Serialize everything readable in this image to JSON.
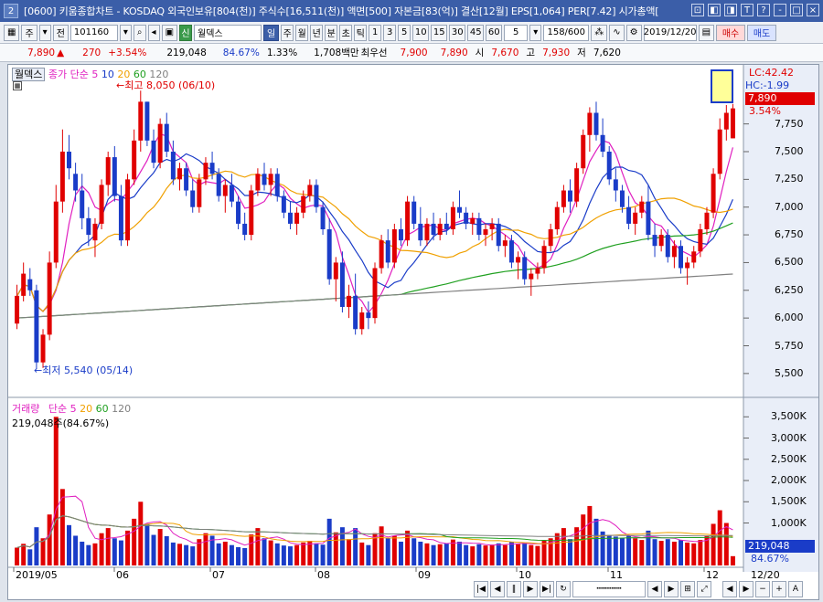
{
  "titlebar": {
    "badge": "2",
    "title": "[0600] 키움종합차트 - KOSDAQ 외국인보유[804(천)] 주식수[16,511(천)] 액면[500] 자본금[83(억)] 결산[12월] EPS[1,064] PER[7.42] 시가총액[",
    "btns": [
      "⊡",
      "◧",
      "◨",
      "T",
      "?",
      "-",
      "□",
      "×"
    ]
  },
  "toolbar": {
    "period_type": "주",
    "prev": "전",
    "code": "101160",
    "stock_name": "월덱스",
    "mode_active": "일",
    "modes": [
      "주",
      "월",
      "년",
      "분",
      "초",
      "틱"
    ],
    "ticks": [
      "1",
      "3",
      "5",
      "10",
      "15",
      "30",
      "45",
      "60"
    ],
    "interval": "5",
    "count": "158/600",
    "date": "2019/12/20",
    "buy": "매수",
    "sell": "매도",
    "sin": "신"
  },
  "infobar": {
    "price": "7,890",
    "arrow": "▲",
    "change": "270",
    "pct": "+3.54%",
    "volume": "219,048",
    "vol_pct": "84.67%",
    "ratio": "1.33%",
    "amount": "1,708백만",
    "best_label": "최우선",
    "best_ask": "7,900",
    "best_bid": "7,890",
    "open_label": "시",
    "open": "7,670",
    "high_label": "고",
    "high": "7,930",
    "low_label": "저",
    "low": "7,620"
  },
  "price_panel": {
    "name": "월덱스",
    "ma_label": "종가 단순",
    "ma_periods": [
      "5",
      "10",
      "20",
      "60",
      "120"
    ],
    "high_note": "최고 8,050 (06/10)",
    "low_note": "최저 5,540 (05/14)",
    "lc": "LC:42.42",
    "hc": "HC:-1.99",
    "last": "7,890",
    "last_pct": "3.54%",
    "ticks": [
      "7,750",
      "7,500",
      "7,250",
      "7,000",
      "6,750",
      "6,500",
      "6,250",
      "6,000",
      "5,750",
      "5,500"
    ]
  },
  "volume_panel": {
    "name": "거래량",
    "ma_label": "단순",
    "ma_periods": [
      "5",
      "20",
      "60",
      "120"
    ],
    "current": "219,048주(84.67%)",
    "ticks": [
      "3,500K",
      "3,000K",
      "2,500K",
      "2,000K",
      "1,500K",
      "1,000K"
    ],
    "last": "219,048",
    "last_pct": "84.67%"
  },
  "xaxis": {
    "labels": [
      "2019/05",
      "06",
      "07",
      "08",
      "09",
      "10",
      "11",
      "12"
    ],
    "right_label": "12/20"
  },
  "colors": {
    "up": "#e00000",
    "down": "#1a3cc8",
    "ma5": "#e020c0",
    "ma10": "#1a3cc8",
    "ma20": "#f0a000",
    "ma60": "#20a020",
    "ma120": "#808080"
  },
  "chart_data": {
    "type": "candlestick",
    "title": "월덱스",
    "ylim": [
      5400,
      8200
    ],
    "candles": [
      [
        5950,
        6300,
        5900,
        6200
      ],
      [
        6200,
        6500,
        6150,
        6400
      ],
      [
        6350,
        6450,
        6200,
        6250
      ],
      [
        6250,
        6300,
        5540,
        5600
      ],
      [
        5600,
        5900,
        5550,
        5850
      ],
      [
        5850,
        6600,
        5800,
        6500
      ],
      [
        6500,
        7200,
        6450,
        7050
      ],
      [
        7050,
        7700,
        6950,
        7500
      ],
      [
        7500,
        7650,
        7250,
        7350
      ],
      [
        7300,
        7400,
        7050,
        7150
      ],
      [
        7150,
        7300,
        6800,
        6900
      ],
      [
        6900,
        7000,
        6650,
        6750
      ],
      [
        6700,
        6900,
        6550,
        6850
      ],
      [
        6850,
        7250,
        6800,
        7200
      ],
      [
        7200,
        7500,
        7100,
        7450
      ],
      [
        7450,
        7550,
        7050,
        7100
      ],
      [
        7100,
        7200,
        6650,
        6700
      ],
      [
        6700,
        7300,
        6650,
        7250
      ],
      [
        7250,
        7700,
        7200,
        7600
      ],
      [
        7600,
        8050,
        7500,
        7950
      ],
      [
        7950,
        7950,
        7550,
        7600
      ],
      [
        7600,
        7700,
        7350,
        7400
      ],
      [
        7400,
        7800,
        7350,
        7750
      ],
      [
        7750,
        7850,
        7450,
        7500
      ],
      [
        7500,
        7600,
        7200,
        7250
      ],
      [
        7250,
        7400,
        7150,
        7350
      ],
      [
        7350,
        7400,
        7100,
        7150
      ],
      [
        7150,
        7250,
        6950,
        7000
      ],
      [
        7000,
        7300,
        6950,
        7250
      ],
      [
        7250,
        7450,
        7200,
        7400
      ],
      [
        7400,
        7500,
        7250,
        7300
      ],
      [
        7300,
        7350,
        7050,
        7100
      ],
      [
        7100,
        7250,
        6950,
        7200
      ],
      [
        7200,
        7300,
        7000,
        7050
      ],
      [
        7050,
        7100,
        6800,
        6850
      ],
      [
        6850,
        6950,
        6700,
        6750
      ],
      [
        6750,
        7200,
        6700,
        7150
      ],
      [
        7150,
        7350,
        7100,
        7300
      ],
      [
        7300,
        7400,
        7150,
        7200
      ],
      [
        7200,
        7350,
        7100,
        7300
      ],
      [
        7300,
        7350,
        7050,
        7100
      ],
      [
        7100,
        7150,
        6900,
        6950
      ],
      [
        6950,
        7050,
        6800,
        6850
      ],
      [
        6850,
        7000,
        6750,
        6950
      ],
      [
        6950,
        7150,
        6900,
        7100
      ],
      [
        7100,
        7250,
        7050,
        7200
      ],
      [
        7200,
        7250,
        6950,
        7000
      ],
      [
        7000,
        7050,
        6750,
        6800
      ],
      [
        6800,
        6900,
        6300,
        6350
      ],
      [
        6350,
        6550,
        6150,
        6500
      ],
      [
        6500,
        6600,
        6050,
        6100
      ],
      [
        6100,
        6300,
        6000,
        6200
      ],
      [
        6200,
        6400,
        5850,
        5900
      ],
      [
        5900,
        6100,
        5850,
        6050
      ],
      [
        6050,
        6150,
        5900,
        6000
      ],
      [
        6000,
        6500,
        5950,
        6450
      ],
      [
        6450,
        6750,
        6400,
        6700
      ],
      [
        6700,
        6800,
        6450,
        6500
      ],
      [
        6500,
        6850,
        6450,
        6800
      ],
      [
        6800,
        6900,
        6650,
        6700
      ],
      [
        6700,
        7100,
        6650,
        7050
      ],
      [
        7050,
        7100,
        6800,
        6850
      ],
      [
        6850,
        7000,
        6650,
        6700
      ],
      [
        6700,
        6900,
        6650,
        6850
      ],
      [
        6850,
        6950,
        6700,
        6750
      ],
      [
        6750,
        6900,
        6700,
        6850
      ],
      [
        6850,
        6950,
        6750,
        6800
      ],
      [
        6800,
        7050,
        6750,
        7000
      ],
      [
        7000,
        7150,
        6900,
        6950
      ],
      [
        6950,
        7000,
        6800,
        6850
      ],
      [
        6850,
        6950,
        6750,
        6900
      ],
      [
        6900,
        6950,
        6700,
        6750
      ],
      [
        6750,
        6850,
        6650,
        6800
      ],
      [
        6800,
        6900,
        6700,
        6850
      ],
      [
        6850,
        6900,
        6600,
        6650
      ],
      [
        6650,
        6750,
        6550,
        6700
      ],
      [
        6700,
        6750,
        6450,
        6500
      ],
      [
        6500,
        6600,
        6350,
        6550
      ],
      [
        6550,
        6600,
        6300,
        6350
      ],
      [
        6350,
        6450,
        6200,
        6400
      ],
      [
        6400,
        6500,
        6350,
        6450
      ],
      [
        6450,
        6700,
        6400,
        6650
      ],
      [
        6650,
        6850,
        6600,
        6800
      ],
      [
        6800,
        7050,
        6750,
        7000
      ],
      [
        7000,
        7200,
        6950,
        7150
      ],
      [
        7150,
        7250,
        6950,
        7050
      ],
      [
        7050,
        7400,
        7000,
        7350
      ],
      [
        7350,
        7700,
        7300,
        7650
      ],
      [
        7650,
        7900,
        7500,
        7850
      ],
      [
        7850,
        7950,
        7600,
        7650
      ],
      [
        7650,
        7800,
        7450,
        7500
      ],
      [
        7500,
        7550,
        7200,
        7250
      ],
      [
        7250,
        7350,
        7050,
        7150
      ],
      [
        7150,
        7200,
        6950,
        7000
      ],
      [
        7000,
        7100,
        6800,
        6850
      ],
      [
        6850,
        7000,
        6750,
        6950
      ],
      [
        6950,
        7100,
        6900,
        7050
      ],
      [
        7050,
        7200,
        6700,
        6750
      ],
      [
        6750,
        6850,
        6550,
        6650
      ],
      [
        6650,
        6800,
        6600,
        6750
      ],
      [
        6750,
        6800,
        6500,
        6550
      ],
      [
        6550,
        6700,
        6450,
        6650
      ],
      [
        6650,
        6700,
        6400,
        6450
      ],
      [
        6450,
        6550,
        6300,
        6500
      ],
      [
        6500,
        6650,
        6450,
        6600
      ],
      [
        6600,
        6850,
        6550,
        6800
      ],
      [
        6800,
        7000,
        6750,
        6950
      ],
      [
        6950,
        7350,
        6900,
        7300
      ],
      [
        7300,
        7800,
        7250,
        7700
      ],
      [
        7700,
        7920,
        7600,
        7850
      ],
      [
        7620,
        7930,
        7620,
        7890
      ]
    ],
    "volume": [
      420,
      510,
      380,
      900,
      640,
      1200,
      3500,
      1800,
      950,
      700,
      560,
      480,
      520,
      760,
      880,
      640,
      590,
      820,
      1100,
      1500,
      980,
      720,
      860,
      690,
      540,
      510,
      480,
      450,
      620,
      760,
      700,
      520,
      560,
      480,
      430,
      410,
      730,
      880,
      640,
      590,
      520,
      470,
      450,
      480,
      540,
      580,
      520,
      490,
      1100,
      780,
      900,
      620,
      880,
      540,
      480,
      760,
      920,
      650,
      700,
      560,
      820,
      640,
      560,
      520,
      480,
      500,
      520,
      610,
      560,
      480,
      450,
      500,
      470,
      490,
      520,
      480,
      560,
      500,
      540,
      480,
      460,
      580,
      640,
      760,
      880,
      620,
      900,
      1200,
      1400,
      1100,
      800,
      720,
      680,
      650,
      700,
      640,
      600,
      820,
      620,
      580,
      620,
      560,
      600,
      540,
      520,
      600,
      700,
      980,
      1300,
      1000,
      219
    ]
  }
}
